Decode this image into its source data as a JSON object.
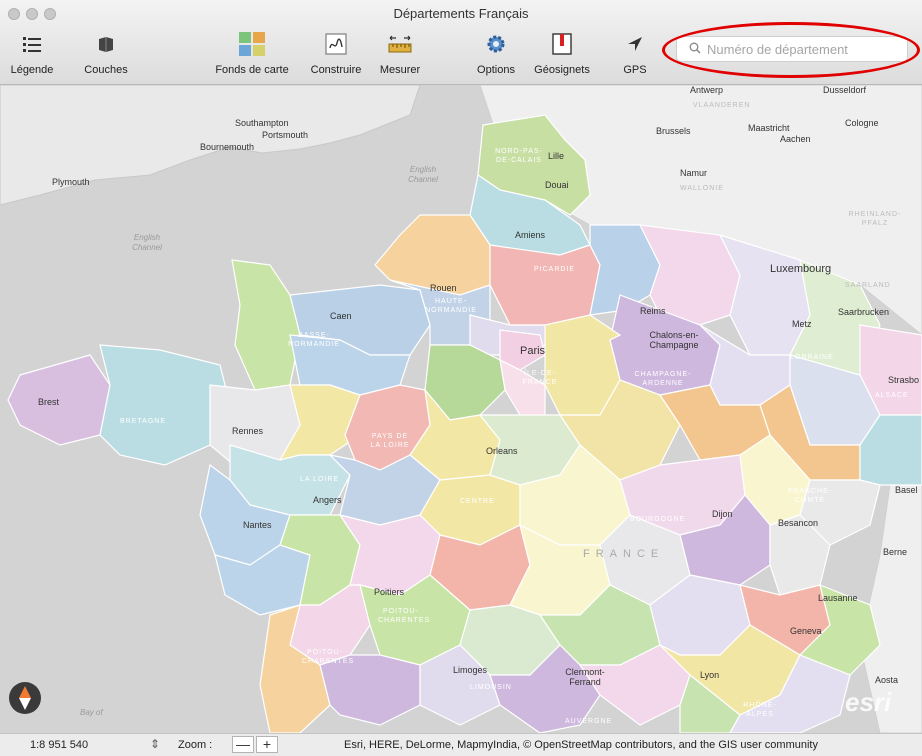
{
  "window": {
    "title": "Départements Français"
  },
  "toolbar": {
    "legend": "Légende",
    "layers": "Couches",
    "basemaps": "Fonds de carte",
    "build": "Construire",
    "measure": "Mesurer",
    "options": "Options",
    "bookmarks": "Géosignets",
    "gps": "GPS"
  },
  "search": {
    "placeholder": "Numéro de département",
    "value": ""
  },
  "map": {
    "cities": {
      "southampton": "Southampton",
      "portsmouth": "Portsmouth",
      "bournemouth": "Bournemouth",
      "plymouth": "Plymouth",
      "antwerp": "Antwerp",
      "dusseldorf": "Dusseldorf",
      "brussels": "Brussels",
      "maastricht": "Maastricht",
      "aachen": "Aachen",
      "cologne": "Cologne",
      "lille": "Lille",
      "douai": "Douai",
      "namur": "Namur",
      "amiens": "Amiens",
      "luxembourg": "Luxembourg",
      "saarbrucken": "Saarbrucken",
      "rouen": "Rouen",
      "caen": "Caen",
      "reims": "Reims",
      "metz": "Metz",
      "paris": "Paris",
      "chalons": "Chalons-en-Champagne",
      "strasbourg": "Strasbo",
      "brest": "Brest",
      "rennes": "Rennes",
      "orleans": "Orleans",
      "angers": "Angers",
      "nantes": "Nantes",
      "dijon": "Dijon",
      "besancon": "Besancon",
      "basel": "Basel",
      "berne": "Berne",
      "poitiers": "Poitiers",
      "lausanne": "Lausanne",
      "geneva": "Geneva",
      "limoges": "Limoges",
      "clermont": "Clermont-Ferrand",
      "lyon": "Lyon",
      "aosta": "Aosta"
    },
    "regions": {
      "nord": "NORD-PAS-DE-CALAIS",
      "vlaanderen": "VLAANDEREN",
      "wallonie": "WALLONIE",
      "rheinland": "RHEINLAND-PFALZ",
      "picardie": "PICARDIE",
      "saarland": "SAARLAND",
      "haute_normandie": "HAUTE-NORMANDIE",
      "basse_normandie": "BASSE-NORMANDIE",
      "ile_de_france": "ÎLE-DE-FRANCE",
      "champagne": "CHAMPAGNE-ARDENNE",
      "lorraine": "LORRAINE",
      "alsace": "ALSACE",
      "bretagne": "BRETAGNE",
      "pays_de_la_loire": "PAYS DE LA LOIRE",
      "centre": "CENTRE",
      "franche_comte": "FRANCHE-COMTÉ",
      "bourgogne": "BOURGOGNE",
      "poitou": "POITOU-CHARENTES",
      "limousin": "LIMOUSIN",
      "auvergne": "AUVERGNE",
      "rhone_alpes": "RHÔNE-ALPES",
      "la_loire": "LA LOIRE"
    },
    "water": {
      "english_channel_1": "English Channel",
      "english_channel_2": "English Channel",
      "bay": "Bay of"
    },
    "country": "FRANCE",
    "attribution_logo": "esri"
  },
  "status": {
    "scale": "1:8 951 540",
    "zoom_label": "Zoom :",
    "zoom_out": "—",
    "zoom_in": "+",
    "attribution": "Esri, HERE, DeLorme, MapmyIndia, © OpenStreetMap contributors, and the GIS user community"
  },
  "colors": {
    "highlight": "#e00000",
    "map_background": "#d4d4d4"
  }
}
